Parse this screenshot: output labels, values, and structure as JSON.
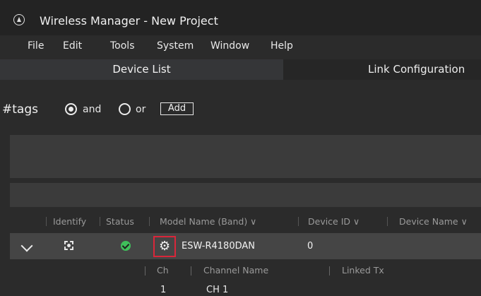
{
  "window": {
    "title": "Wireless Manager - New Project"
  },
  "menu": [
    "File",
    "Edit",
    "Tools",
    "System",
    "Window",
    "Help"
  ],
  "tabs": [
    "Device List",
    "Link Configuration"
  ],
  "tags": {
    "label": "#tags",
    "and_label": "and",
    "or_label": "or",
    "add_label": "Add",
    "selected": "and"
  },
  "columns": [
    "Identify",
    "Status",
    "Model Name (Band) ∨",
    "Device ID ∨",
    "Device Name ∨"
  ],
  "device": {
    "model": "ESW-R4180DAN",
    "id": "0",
    "status": "ok"
  },
  "channel_columns": [
    "Ch",
    "Channel Name",
    "Linked Tx"
  ],
  "channels": [
    {
      "ch": "1",
      "name": "CH 1"
    }
  ],
  "colors": {
    "status_ok": "#3fbf5a",
    "highlight": "#d9263a"
  }
}
